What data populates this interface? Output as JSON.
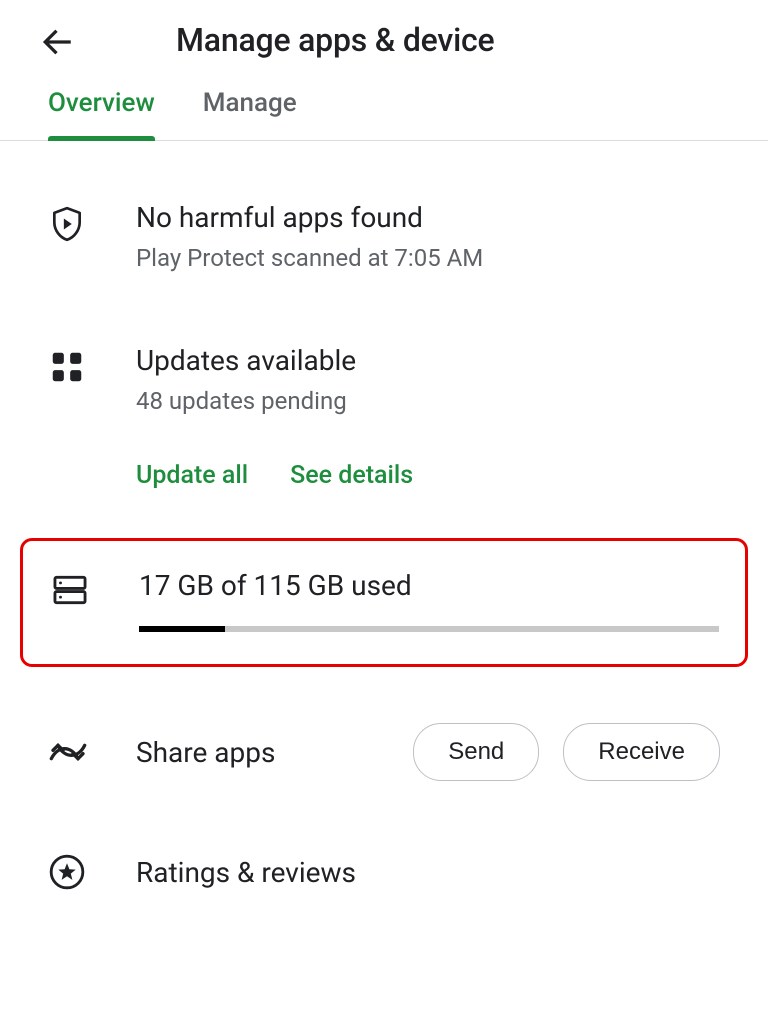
{
  "header": {
    "title": "Manage apps & device"
  },
  "tabs": {
    "overview": "Overview",
    "manage": "Manage"
  },
  "protect": {
    "title": "No harmful apps found",
    "sub": "Play Protect scanned at 7:05 AM"
  },
  "updates": {
    "title": "Updates available",
    "sub": "48 updates pending",
    "update_all": "Update all",
    "see_details": "See details"
  },
  "storage": {
    "text": "17 GB of 115 GB used"
  },
  "share": {
    "title": "Share apps",
    "send": "Send",
    "receive": "Receive"
  },
  "ratings": {
    "title": "Ratings & reviews"
  }
}
